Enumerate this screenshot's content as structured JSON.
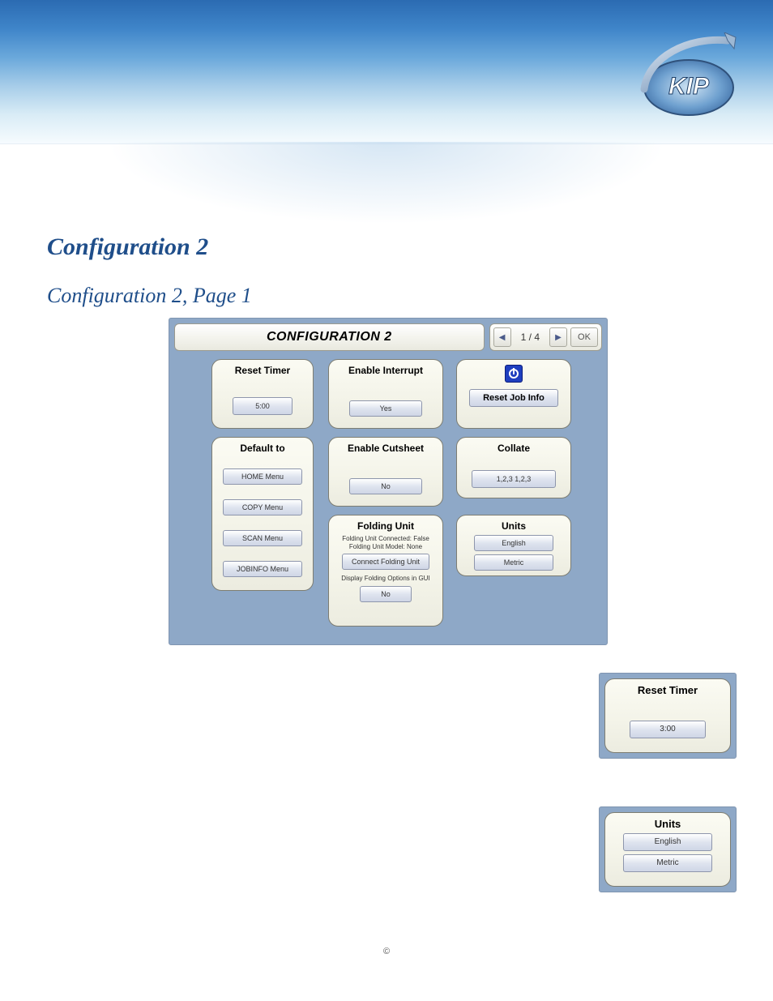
{
  "logo_text": "KIP",
  "page": {
    "title": "Configuration 2",
    "subtitle": "Configuration 2, Page 1"
  },
  "main_panel": {
    "header_title": "CONFIGURATION 2",
    "pager": {
      "prev": "◀",
      "text": "1 / 4",
      "next": "▶",
      "ok": "OK"
    },
    "cards": {
      "reset_timer": {
        "title": "Reset Timer",
        "value": "5:00"
      },
      "enable_interrupt": {
        "title": "Enable Interrupt",
        "value": "Yes"
      },
      "reset_job": {
        "button": "Reset Job Info"
      },
      "default_to": {
        "title": "Default to",
        "opts": [
          "HOME Menu",
          "COPY Menu",
          "SCAN Menu",
          "JOBINFO Menu"
        ]
      },
      "enable_cutsheet": {
        "title": "Enable Cutsheet",
        "value": "No"
      },
      "collate": {
        "title": "Collate",
        "value": "1,2,3 1,2,3"
      },
      "folding": {
        "title": "Folding Unit",
        "line1": "Folding Unit Connected: False",
        "line2": "Folding Unit Model: None",
        "connect_btn": "Connect Folding Unit",
        "display_label": "Display Folding Options in GUI",
        "display_value": "No"
      },
      "units": {
        "title": "Units",
        "opts": [
          "English",
          "Metric"
        ]
      }
    }
  },
  "side_reset_timer": {
    "title": "Reset Timer",
    "value": "3:00"
  },
  "side_units": {
    "title": "Units",
    "opts": [
      "English",
      "Metric"
    ]
  },
  "footer": "©"
}
